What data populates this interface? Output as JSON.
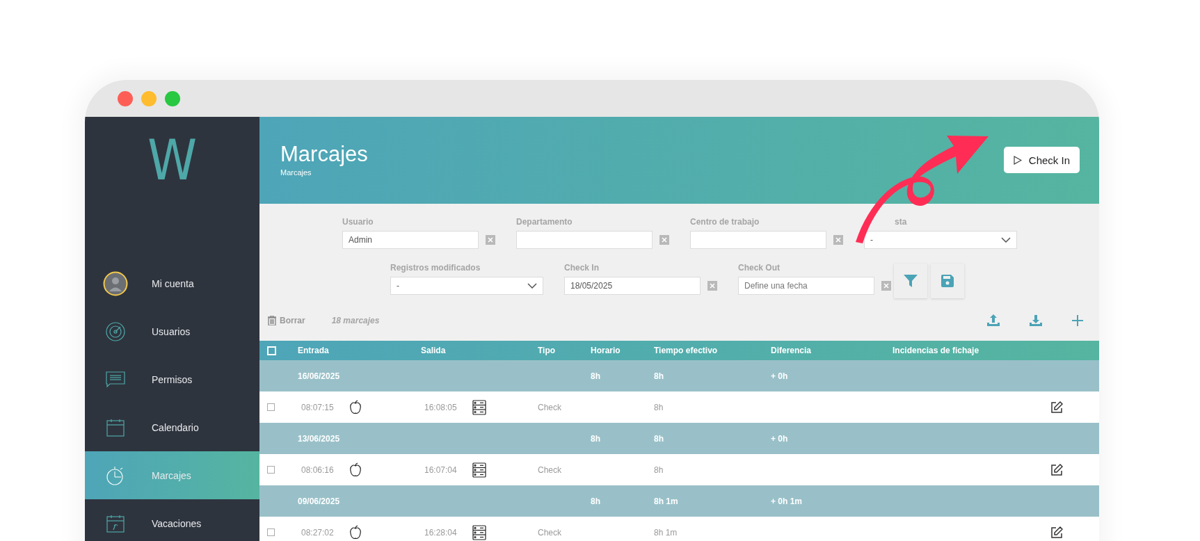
{
  "sidebar": {
    "logo": "W",
    "items": [
      {
        "label": "Mi cuenta",
        "selected": false
      },
      {
        "label": "Usuarios",
        "selected": false
      },
      {
        "label": "Permisos",
        "selected": false
      },
      {
        "label": "Calendario",
        "selected": false
      },
      {
        "label": "Marcajes",
        "selected": true
      },
      {
        "label": "Vacaciones",
        "selected": false
      }
    ]
  },
  "header": {
    "title": "Marcajes",
    "breadcrumb": "Marcajes",
    "button": "Check In"
  },
  "filters": [
    [
      {
        "kind": "text",
        "label": "Usuario",
        "value": "Admin"
      },
      {
        "kind": "text",
        "label": "Departamento"
      },
      {
        "kind": "text",
        "label": "Centro de trabajo"
      },
      {
        "kind": "select",
        "label": "sta",
        "value": "-"
      }
    ],
    [
      {
        "kind": "select",
        "label": "Registros modificados",
        "value": "-"
      },
      {
        "kind": "text",
        "label": "Check In",
        "value": "18/05/2025"
      },
      {
        "kind": "text",
        "label": "Check Out",
        "placeholder": "Define una fecha"
      }
    ]
  ],
  "toolbar": {
    "delete": "Borrar",
    "count": "18 marcajes"
  },
  "table": {
    "select_all_checked": false,
    "columns": [
      "Entrada",
      "Salida",
      "Tipo",
      "Horario",
      "Tiempo efectivo",
      "Diferencia",
      "Incidencias de fichaje"
    ],
    "groups": [
      {
        "date": "16/06/2025",
        "horario": "8h",
        "tiempo": "8h",
        "diferencia": "+ 0h",
        "entries": [
          {
            "checked": false,
            "entrada": "08:07:15",
            "salida": "16:08:05",
            "tipo": "Check",
            "tiempo": "8h"
          }
        ]
      },
      {
        "date": "13/06/2025",
        "horario": "8h",
        "tiempo": "8h",
        "diferencia": "+ 0h",
        "entries": [
          {
            "checked": false,
            "entrada": "08:06:16",
            "salida": "16:07:04",
            "tipo": "Check",
            "tiempo": "8h"
          }
        ]
      },
      {
        "date": "09/06/2025",
        "horario": "8h",
        "tiempo": "8h 1m",
        "diferencia": "+ 0h 1m",
        "entries": [
          {
            "checked": false,
            "entrada": "08:27:02",
            "salida": "16:28:04",
            "tipo": "Check",
            "tiempo": "8h 1m"
          }
        ]
      }
    ]
  }
}
